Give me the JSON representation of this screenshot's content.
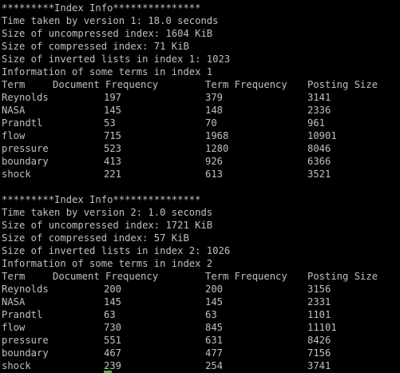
{
  "terminal": {
    "cursor_color": "#3fbf3f",
    "text_color": "#c0c0c0",
    "background": "#000000",
    "blocks": [
      {
        "banner": "*********Index Info***************",
        "time": "Time taken by version 1: 18.0 seconds",
        "uncompressed": "Size of uncompressed index: 1604 KiB",
        "compressed": "Size of compressed index: 71 KiB",
        "inverted": "Size of inverted lists in index 1: 1023",
        "info": "Information of some terms in index 1",
        "headers": [
          "Term",
          "Document Frequency",
          "Term Frequency",
          "Posting Size"
        ],
        "rows": [
          [
            "Reynolds",
            "197",
            "379",
            "3141"
          ],
          [
            "NASA",
            "145",
            "148",
            "2336"
          ],
          [
            "Prandtl",
            "53",
            "70",
            "961"
          ],
          [
            "flow",
            "715",
            "1968",
            "10901"
          ],
          [
            "pressure",
            "523",
            "1280",
            "8046"
          ],
          [
            "boundary",
            "413",
            "926",
            "6366"
          ],
          [
            "shock",
            "221",
            "613",
            "3521"
          ]
        ]
      },
      {
        "banner": "*********Index Info***************",
        "time": "Time taken by version 2: 1.0 seconds",
        "uncompressed": "Size of uncompressed index: 1721 KiB",
        "compressed": "Size of compressed index: 57 KiB",
        "inverted": "Size of inverted lists in index 2: 1026",
        "info": "Information of some terms in index 2",
        "headers": [
          "Term",
          "Document Frequency",
          "Term Frequency",
          "Posting Size"
        ],
        "rows": [
          [
            "Reynolds",
            "200",
            "200",
            "3156"
          ],
          [
            "NASA",
            "145",
            "145",
            "2331"
          ],
          [
            "Prandtl",
            "63",
            "63",
            "1101"
          ],
          [
            "flow",
            "730",
            "845",
            "11101"
          ],
          [
            "pressure",
            "551",
            "631",
            "8426"
          ],
          [
            "boundary",
            "467",
            "477",
            "7156"
          ],
          [
            "shock",
            "239",
            "254",
            "3741"
          ]
        ]
      }
    ]
  }
}
